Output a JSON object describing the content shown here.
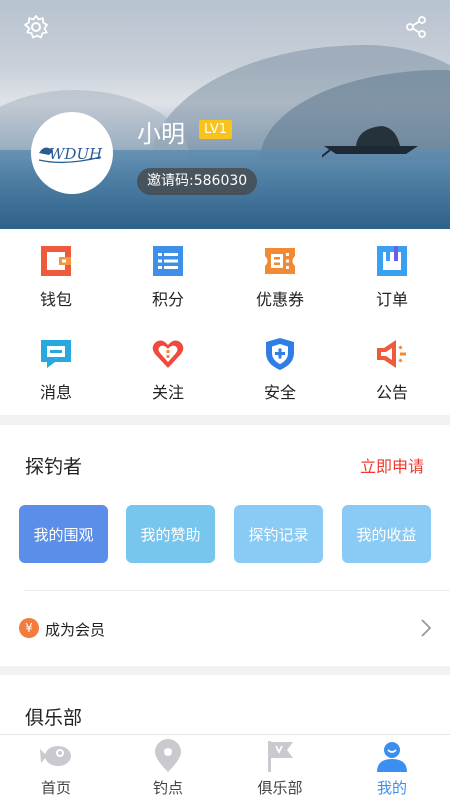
{
  "profile": {
    "name": "小明",
    "level": "LV1",
    "invite": "邀请码:586030",
    "avatar_text": "WDUH"
  },
  "header_icons": [
    "settings-icon",
    "share-icon"
  ],
  "grid": [
    {
      "label": "钱包",
      "icon": "wallet-icon"
    },
    {
      "label": "积分",
      "icon": "points-icon"
    },
    {
      "label": "优惠券",
      "icon": "coupon-icon"
    },
    {
      "label": "订单",
      "icon": "order-icon"
    },
    {
      "label": "消息",
      "icon": "message-icon"
    },
    {
      "label": "关注",
      "icon": "heart-icon"
    },
    {
      "label": "安全",
      "icon": "shield-icon"
    },
    {
      "label": "公告",
      "icon": "megaphone-icon"
    }
  ],
  "explorer": {
    "title": "探钓者",
    "apply_label": "立即申请",
    "tiles": [
      {
        "label": "我的围观",
        "color": "#5b8ee8"
      },
      {
        "label": "我的赞助",
        "color": "#78c6ee"
      },
      {
        "label": "探钓记录",
        "color": "#89cbf4"
      },
      {
        "label": "我的收益",
        "color": "#89cbf4"
      }
    ],
    "member_icon": "¥",
    "member_label": "成为会员"
  },
  "club": {
    "title": "俱乐部"
  },
  "tabs": [
    {
      "label": "首页",
      "icon": "fish-icon",
      "active": false
    },
    {
      "label": "钓点",
      "icon": "location-pin-icon",
      "active": false
    },
    {
      "label": "俱乐部",
      "icon": "flag-icon",
      "active": false
    },
    {
      "label": "我的",
      "icon": "user-icon",
      "active": true
    }
  ],
  "colors": {
    "accent": "#3b8ff0",
    "apply": "#ef3a2c",
    "badge": "#f7c31c",
    "member": "#f27b3d"
  }
}
